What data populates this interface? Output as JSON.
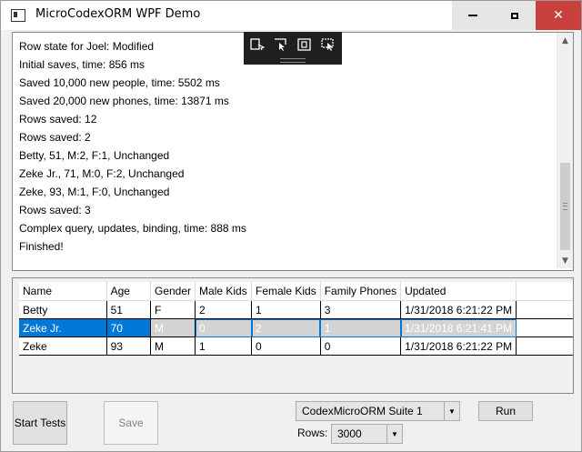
{
  "window": {
    "title": "MicroCodexORM WPF Demo",
    "minimize_glyph": "minimize-icon",
    "maximize_glyph": "maximize-icon",
    "close_glyph": "✕"
  },
  "log": {
    "lines": [
      "Row state for Joel: Modified",
      "Initial saves, time: 856 ms",
      "Saved 10,000 new people, time: 5502 ms",
      "Saved 20,000 new phones, time: 13871 ms",
      "Rows saved: 12",
      "Rows saved: 2",
      "Betty, 51, M:2, F:1, Unchanged",
      "Zeke Jr., 71, M:0, F:2, Unchanged",
      "Zeke, 93, M:1, F:0, Unchanged",
      "Rows saved: 3",
      "Complex query, updates, binding, time: 888 ms",
      "Finished!"
    ]
  },
  "grid": {
    "columns": [
      "Name",
      "Age",
      "Gender",
      "Male Kids",
      "Female Kids",
      "Family Phones",
      "Updated"
    ],
    "rows": [
      [
        "Betty",
        "51",
        "F",
        "2",
        "1",
        "3",
        "1/31/2018 6:21:22 PM"
      ],
      [
        "Zeke Jr.",
        "70",
        "M",
        "0",
        "2",
        "1",
        "1/31/2018 6:21:41 PM"
      ],
      [
        "Zeke",
        "93",
        "M",
        "1",
        "0",
        "0",
        "1/31/2018 6:21:22 PM"
      ]
    ]
  },
  "controls": {
    "start_label": "Start Tests",
    "save_label": "Save",
    "run_label": "Run",
    "suite_value": "CodexMicroORM Suite 1",
    "rows_label": "Rows:",
    "rows_value": "3000"
  },
  "colors": {
    "selection": "#0078d7",
    "close_button": "#c8413c"
  }
}
